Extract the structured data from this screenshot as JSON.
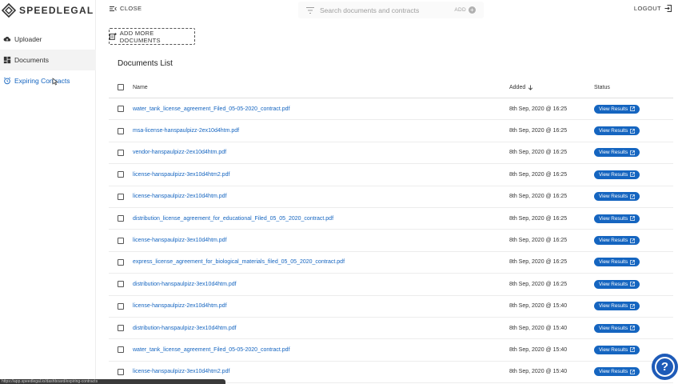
{
  "app": {
    "logo_text": "SPEEDLEGAL"
  },
  "sidebar": {
    "items": [
      {
        "label": "Uploader",
        "icon": "cloud-upload-icon"
      },
      {
        "label": "Documents",
        "icon": "dashboard-icon"
      },
      {
        "label": "Expiring Contracts",
        "icon": "alarm-clock-icon"
      }
    ]
  },
  "topbar": {
    "close_label": "CLOSE",
    "search_placeholder": "Search documents and contracts",
    "add_label": "ADD",
    "logout_label": "LOGOUT"
  },
  "main": {
    "add_docs_label": "ADD MORE DOCUMENTS",
    "list_title": "Documents List",
    "columns": {
      "name": "Name",
      "added": "Added",
      "status": "Status"
    },
    "view_label": "View Results",
    "rows": [
      {
        "name": "water_tank_license_agreement_Filed_05-05-2020_contract.pdf",
        "added": "8th Sep, 2020 @ 16:25"
      },
      {
        "name": "msa-license-hanspaulpizz-2ex10d4htm.pdf",
        "added": "8th Sep, 2020 @ 16:25"
      },
      {
        "name": "vendor-hanspaulpizz-2ex10d4htm.pdf",
        "added": "8th Sep, 2020 @ 16:25"
      },
      {
        "name": "license-hanspaulpizz-3ex10d4htm2.pdf",
        "added": "8th Sep, 2020 @ 16:25"
      },
      {
        "name": "license-hanspaulpizz-2ex10d4htm.pdf",
        "added": "8th Sep, 2020 @ 16:25"
      },
      {
        "name": "distribution_license_agreement_for_educational_Filed_05_05_2020_contract.pdf",
        "added": "8th Sep, 2020 @ 16:25"
      },
      {
        "name": "license-hanspaulpizz-3ex10d4htm.pdf",
        "added": "8th Sep, 2020 @ 16:25"
      },
      {
        "name": "express_license_agreement_for_biological_materials_filed_05_05_2020_contract.pdf",
        "added": "8th Sep, 2020 @ 16:25"
      },
      {
        "name": "distribution-hanspaulpizz-3ex10d4htm.pdf",
        "added": "8th Sep, 2020 @ 16:25"
      },
      {
        "name": "license-hanspaulpizz-2ex10d4htm.pdf",
        "added": "8th Sep, 2020 @ 15:40"
      },
      {
        "name": "distribution-hanspaulpizz-3ex10d4htm.pdf",
        "added": "8th Sep, 2020 @ 15:40"
      },
      {
        "name": "water_tank_license_agreement_Filed_05-05-2020_contract.pdf",
        "added": "8th Sep, 2020 @ 15:40"
      },
      {
        "name": "license-hanspaulpizz-3ex10d4htm2.pdf",
        "added": "8th Sep, 2020 @ 15:40"
      }
    ]
  },
  "statusbar": {
    "url": "https://app.speedlegal.io/dashboard/expiring-contracts"
  },
  "colors": {
    "accent": "#1565c0",
    "help": "#1e5bb8"
  }
}
